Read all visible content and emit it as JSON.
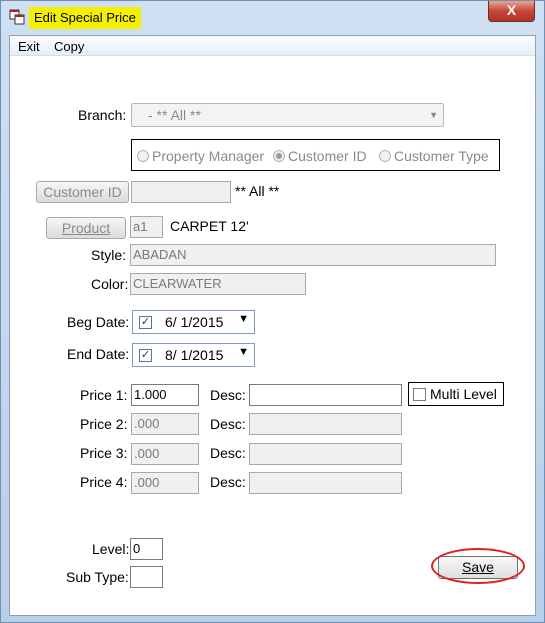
{
  "window": {
    "title": "Edit Special Price",
    "close_glyph": "X"
  },
  "menu": {
    "exit": "Exit",
    "copy": "Copy"
  },
  "branch": {
    "label": "Branch:",
    "value": "- ** All **"
  },
  "lookup_type": {
    "options": [
      "Property Manager",
      "Customer ID",
      "Customer Type"
    ],
    "selected": "Customer ID"
  },
  "customer": {
    "button_label": "Customer ID",
    "value": "",
    "all_text": "** All **"
  },
  "product": {
    "button_label": "Product",
    "code": "a1",
    "description": "CARPET 12'"
  },
  "style": {
    "label": "Style:",
    "value": "ABADAN"
  },
  "color": {
    "label": "Color:",
    "value": "CLEARWATER"
  },
  "beg_date": {
    "label": "Beg Date:",
    "checked": true,
    "value": "6/  1/2015"
  },
  "end_date": {
    "label": "End Date:",
    "checked": true,
    "value": "8/  1/2015"
  },
  "prices": [
    {
      "label": "Price 1:",
      "value": "1.000",
      "desc_label": "Desc:",
      "desc": ""
    },
    {
      "label": "Price 2:",
      "value": ".000",
      "desc_label": "Desc:",
      "desc": ""
    },
    {
      "label": "Price 3:",
      "value": ".000",
      "desc_label": "Desc:",
      "desc": ""
    },
    {
      "label": "Price 4:",
      "value": ".000",
      "desc_label": "Desc:",
      "desc": ""
    }
  ],
  "multi_level": {
    "label": "Multi Level",
    "checked": false
  },
  "level": {
    "label": "Level:",
    "value": "0"
  },
  "sub_type": {
    "label": "Sub Type:",
    "value": ""
  },
  "save": {
    "label": "Save"
  },
  "icons": {
    "app": "app-window-icon",
    "close": "close-icon",
    "check": "checkmark-icon",
    "dropdown": "chevron-down-icon"
  },
  "colors": {
    "title_highlight": "#f4f000",
    "close_button": "#c6473a",
    "annotation_ring": "#e02020"
  }
}
